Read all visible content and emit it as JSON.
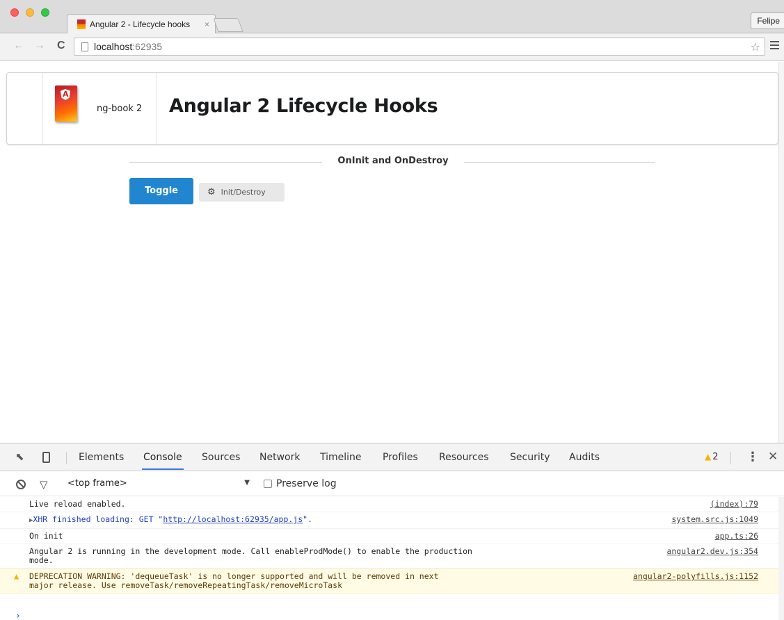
{
  "browser": {
    "tab_title": "Angular 2 - Lifecycle hooks",
    "tab_close": "×",
    "profile_name": "Felipe",
    "url_host": "localhost",
    "url_port": ":62935"
  },
  "page": {
    "brand_name": "ng-book 2",
    "title": "Angular 2 Lifecycle Hooks",
    "section_label": "OnInit and OnDestroy",
    "toggle_label": "Toggle",
    "badge_label": "Init/Destroy"
  },
  "devtools": {
    "tabs": [
      "Elements",
      "Console",
      "Sources",
      "Network",
      "Timeline",
      "Profiles",
      "Resources",
      "Security",
      "Audits"
    ],
    "active_tab": "Console",
    "warning_count": "2",
    "frame_select": "<top frame>",
    "preserve_log": "Preserve log",
    "rows": [
      {
        "type": "log",
        "message": "Live reload enabled.",
        "source": "(index):79"
      },
      {
        "type": "xhr",
        "prefix": "XHR finished loading: GET \"",
        "url": "http://localhost:62935/app.js",
        "suffix": "\".",
        "source": "system.src.js:1049"
      },
      {
        "type": "log",
        "message": "On init",
        "source": "app.ts:26"
      },
      {
        "type": "log",
        "message": "Angular 2 is running in the development mode. Call enableProdMode() to enable the production\nmode.",
        "source": "angular2.dev.js:354"
      },
      {
        "type": "warn",
        "message": "DEPRECATION WARNING: 'dequeueTask' is no longer supported and will be removed in next\nmajor release. Use removeTask/removeRepeatingTask/removeMicroTask",
        "source": "angular2-polyfills.js:1152"
      }
    ]
  },
  "colors": {
    "primary_button": "#2185d0",
    "warning": "#f4b400",
    "active_tab_underline": "#3879d9"
  }
}
